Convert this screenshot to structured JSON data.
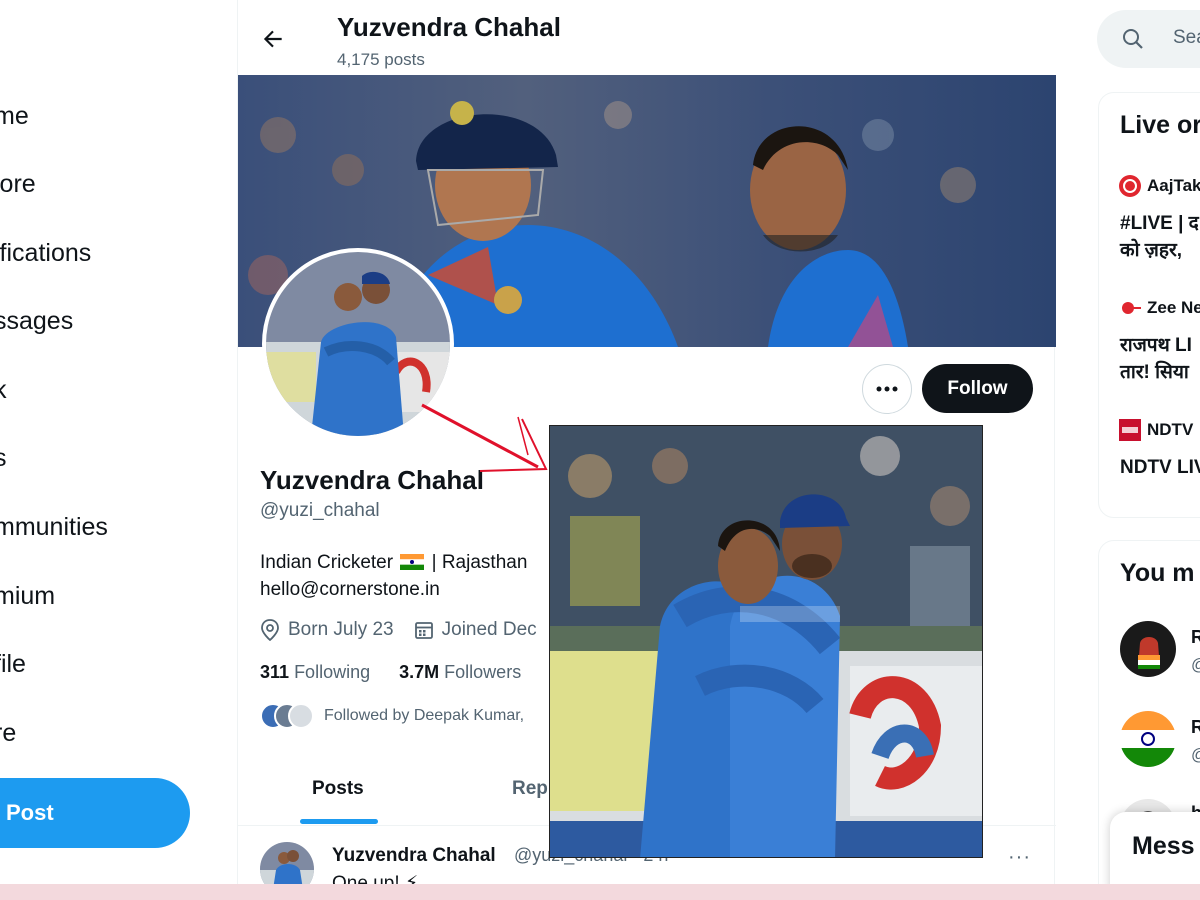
{
  "nav": {
    "items": [
      "me",
      "lore",
      "ifications",
      "ssages",
      "k",
      "s",
      "mmunities",
      "mium",
      "file",
      "re"
    ],
    "post_label": "Post"
  },
  "header": {
    "name": "Yuzvendra Chahal",
    "post_count": "4,175 posts"
  },
  "profile": {
    "name": "Yuzvendra Chahal",
    "handle": "@yuzi_chahal",
    "bio_line1_a": "Indian Cricketer",
    "bio_line1_b": "| Rajasthan",
    "bio_line2": "hello@cornerstone.in",
    "born": "Born July 23",
    "joined": "Joined Dec",
    "following_count": "311",
    "following_label": "Following",
    "followers_count": "3.7M",
    "followers_label": "Followers",
    "followed_by": "Followed by Deepak Kumar,",
    "follow_label": "Follow"
  },
  "tabs": {
    "posts": "Posts",
    "replies": "Rep"
  },
  "tweet": {
    "name": "Yuzvendra Chahal",
    "handle": "@yuzi_chahal · 2 h",
    "text": "One up! ⚡",
    "more": "···"
  },
  "right": {
    "search_placeholder": "Sea",
    "live_title": "Live or",
    "live_items": [
      {
        "source": "AajTak",
        "text1": "#LIVE | द",
        "text2": "को ज़हर, "
      },
      {
        "source": "Zee Ne",
        "text1": "राजपथ LI",
        "text2": "तार! सिया"
      },
      {
        "source": "NDTV",
        "text1": "NDTV LIV",
        "text2": ""
      }
    ],
    "suggest_title": "You m",
    "suggest_letters": [
      "R",
      "R",
      "h"
    ],
    "suggest_at": [
      "@",
      "@"
    ],
    "messages_label": "Mess"
  },
  "colors": {
    "accent": "#1d9bf0",
    "text": "#0f1419",
    "muted": "#536471",
    "follow_bg": "#0f1419"
  }
}
